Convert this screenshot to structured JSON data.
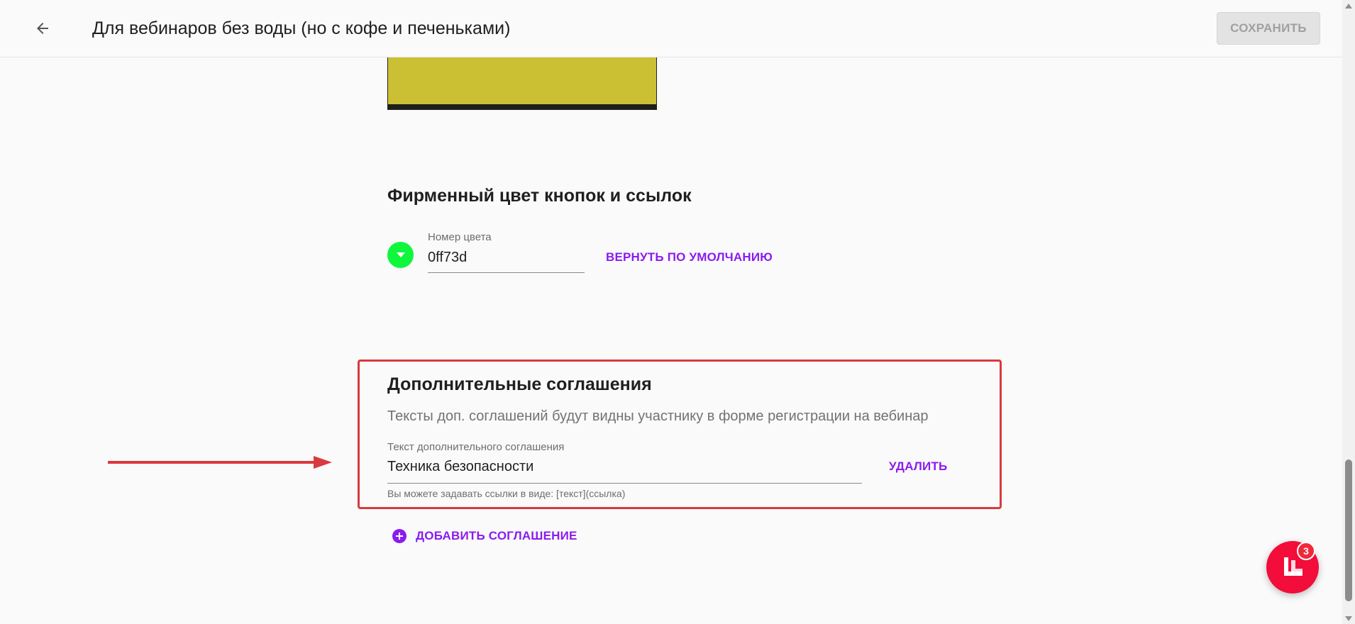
{
  "header": {
    "title": "Для вебинаров без воды (но с кофе и печеньками)",
    "save_label": "СОХРАНИТЬ",
    "back_icon": "arrow-left-icon"
  },
  "preview": {
    "swatch_color": "#cbc034"
  },
  "brand_color": {
    "heading": "Фирменный цвет кнопок и ссылок",
    "color_hex": "#0ff73d",
    "field_label": "Номер цвета",
    "field_value": "0ff73d",
    "reset_label": "ВЕРНУТЬ ПО УМОЛЧАНИЮ"
  },
  "agreements": {
    "heading": "Дополнительные соглашения",
    "description": "Тексты доп. соглашений будут видны участнику в форме регистрации на вебинар",
    "items": [
      {
        "field_label": "Текст дополнительного соглашения",
        "value": "Техника безопасности",
        "hint": "Вы можете задавать ссылки в виде: [текст](ссылка)",
        "delete_label": "УДАЛИТЬ"
      }
    ],
    "add_label": "ДОБАВИТЬ СОГЛАШЕНИЕ"
  },
  "chat": {
    "badge_count": "3",
    "color": "#f20d3a"
  },
  "colors": {
    "accent": "#8a1cf0",
    "highlight": "#d9393f",
    "annotation_arrow": "#d9393f"
  }
}
